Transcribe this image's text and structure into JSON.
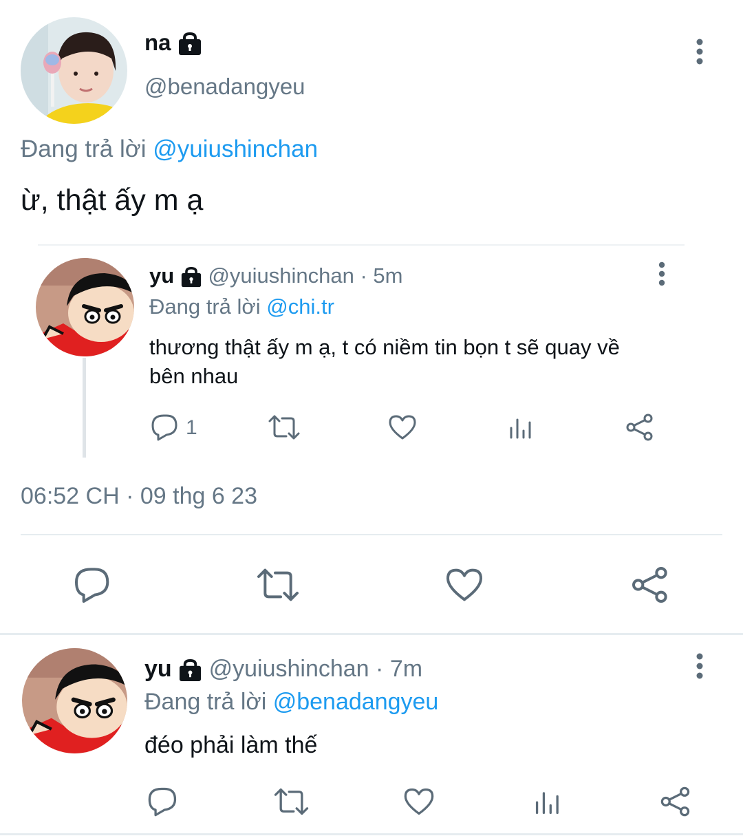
{
  "main_tweet": {
    "name": "na",
    "handle": "@benadangyeu",
    "replying_prefix": "Đang trả lời",
    "replying_to": "@yuiushinchan",
    "text": "ừ, thật ấy m ạ",
    "timestamp": "06:52 CH · 09 thg 6 23"
  },
  "quoted_tweet": {
    "name": "yu",
    "handle": "@yuiushinchan",
    "time": "· 5m",
    "replying_prefix": "Đang trả lời",
    "replying_to": "@chi.tr",
    "text_line1": "thương thật ấy m ạ, t có niềm tin bọn t sẽ quay về",
    "text_line2": "bên nhau",
    "reply_count": "1"
  },
  "reply_tweet": {
    "name": "yu",
    "handle": "@yuiushinchan",
    "time": "· 7m",
    "replying_prefix": "Đang trả lời",
    "replying_to": "@benadangyeu",
    "text": "đéo phải làm thế"
  },
  "colors": {
    "link": "#1d9bf0",
    "secondary_text": "#657786",
    "icon": "#5b6b78",
    "divider": "#e6ecf0"
  }
}
